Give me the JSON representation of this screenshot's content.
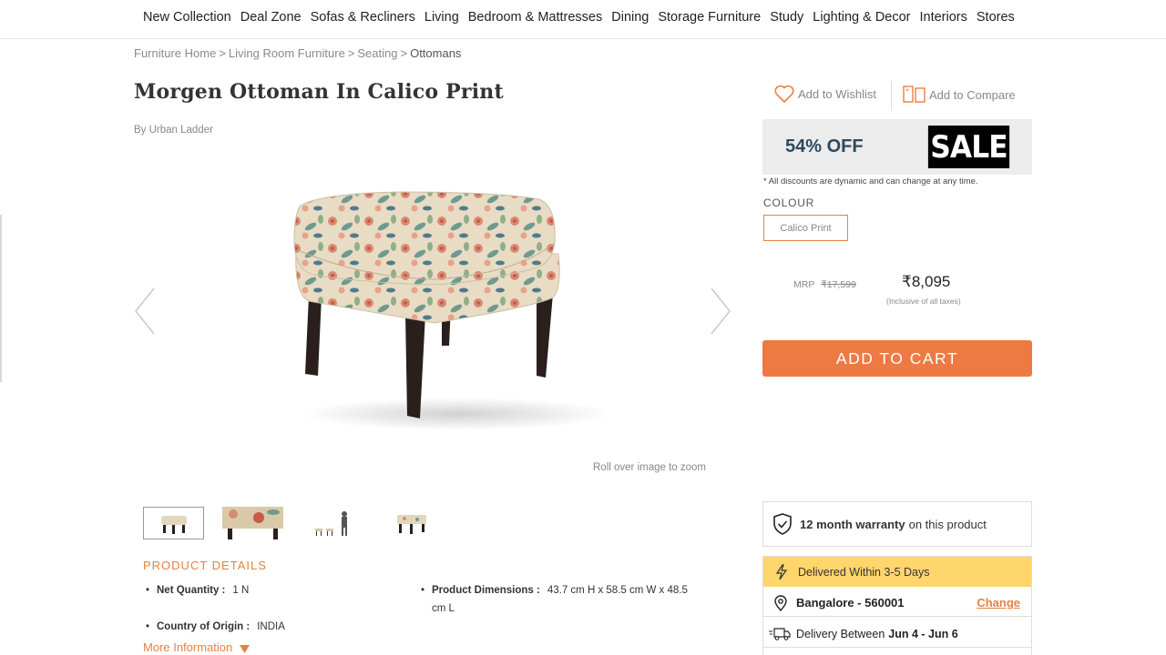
{
  "nav": {
    "items": [
      "New Collection",
      "Deal Zone",
      "Sofas & Recliners",
      "Living",
      "Bedroom & Mattresses",
      "Dining",
      "Storage Furniture",
      "Study",
      "Lighting & Decor",
      "Interiors",
      "Stores"
    ]
  },
  "breadcrumb": {
    "items": [
      "Furniture Home",
      "Living Room Furniture",
      "Seating"
    ],
    "current": "Ottomans",
    "separator": ">"
  },
  "product": {
    "title": "Morgen Ottoman In Calico Print",
    "byline": "By Urban Ladder",
    "zoom_hint": "Roll over image to zoom"
  },
  "details": {
    "heading": "PRODUCT DETAILS",
    "net_quantity_label": "Net Quantity :",
    "net_quantity_value": "1 N",
    "dimensions_label": "Product Dimensions :",
    "dimensions_value_line1": "43.7 cm H x 58.5 cm W x 48.5",
    "dimensions_value_line2": "cm L",
    "origin_label": "Country of Origin :",
    "origin_value": "INDIA",
    "more_info": "More Information"
  },
  "actions": {
    "wishlist": "Add to Wishlist",
    "compare": "Add to Compare"
  },
  "sale": {
    "off": "54% OFF",
    "badge": "SALE",
    "disclaimer": "* All discounts are dynamic and can change at any time."
  },
  "colour": {
    "label": "COLOUR",
    "selected": "Calico Print"
  },
  "pricing": {
    "mrp_label": "MRP",
    "mrp_value": "₹17,599",
    "price": "₹8,095",
    "tax_note": "(Inclusive of all taxes)"
  },
  "cart": {
    "label": "ADD TO CART"
  },
  "warranty": {
    "bold": "12 month warranty",
    "rest": "on this product"
  },
  "delivery": {
    "fast": "Delivered Within 3-5 Days",
    "location": "Bangalore - 560001",
    "change": "Change",
    "between_label": "Delivery Between",
    "between_dates": "Jun 4 - Jun 6"
  },
  "colors": {
    "accent": "#ee7a43",
    "sale_text": "#2d4a5e",
    "delivery_highlight": "#ffd66b"
  }
}
